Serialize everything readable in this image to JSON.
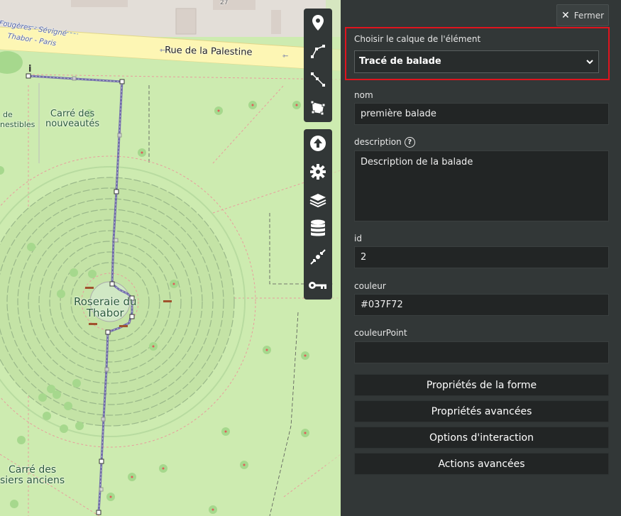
{
  "map": {
    "street_name": "Rue de la Palestine",
    "tram_label_1": "Fougères - Sévigné",
    "tram_label_2": "Thabor - Paris",
    "building_number": "27",
    "place_carre_nouveautes": "Carré des\nnouveautés",
    "place_roseraie": "Roseraie du\nThabor",
    "place_carre_poiriers": "Carré des\nsiers anciens",
    "place_edge_1": "de",
    "place_edge_2": "nestibles"
  },
  "toolbar": {
    "group1": [
      {
        "name": "marker-icon",
        "label": "Dessiner un marqueur"
      },
      {
        "name": "polyline-icon",
        "label": "Dessiner une ligne"
      },
      {
        "name": "multiline-icon",
        "label": "Dessiner une ligne"
      },
      {
        "name": "polygon-icon",
        "label": "Dessiner un polygone"
      }
    ],
    "group2": [
      {
        "name": "upload-icon",
        "label": "Importer"
      },
      {
        "name": "settings-icon",
        "label": "Paramètres"
      },
      {
        "name": "layers-icon",
        "label": "Calques"
      },
      {
        "name": "database-icon",
        "label": "Données"
      },
      {
        "name": "centroid-icon",
        "label": "Centrer"
      },
      {
        "name": "key-icon",
        "label": "Permissions"
      }
    ]
  },
  "panel": {
    "close_label": "Fermer",
    "layer_label": "Choisir le calque de l'élément",
    "layer_selected": "Tracé de balade",
    "fields": {
      "nom_label": "nom",
      "nom_value": "première balade",
      "description_label": "description",
      "description_value": "Description de la balade",
      "id_label": "id",
      "id_value": "2",
      "couleur_label": "couleur",
      "couleur_value": "#037F72",
      "couleurpoint_label": "couleurPoint",
      "couleurpoint_value": ""
    },
    "sections": [
      "Propriétés de la forme",
      "Propriétés avancées",
      "Options d'interaction",
      "Actions avancées"
    ]
  },
  "colors": {
    "highlight_border": "#e0141e",
    "panel_bg": "#323737",
    "route_line": "#5a4fa8",
    "park_green": "#cdebb0",
    "road_yellow": "#fdf6b4"
  }
}
